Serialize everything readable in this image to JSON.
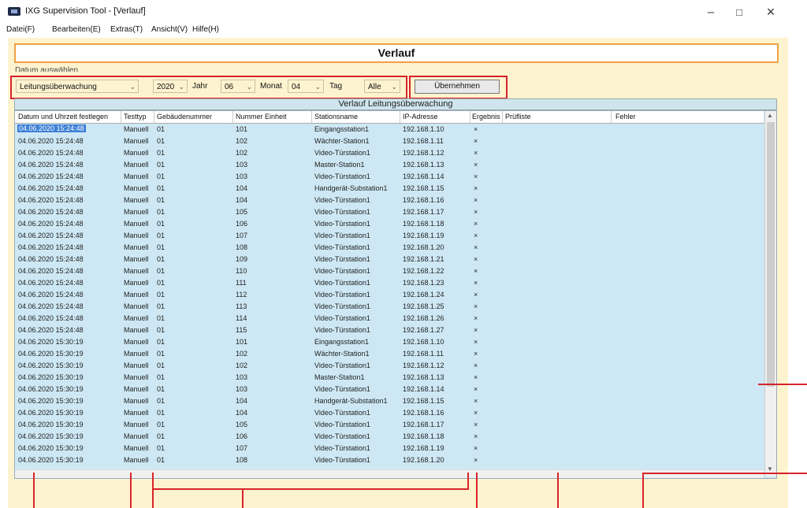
{
  "window": {
    "title": "IXG Supervision Tool - [Verlauf]",
    "controls": {
      "minimize": "–",
      "maximize": "□",
      "close": "×"
    }
  },
  "menu": [
    "Datei(F)",
    "Bearbeiten(E)",
    "Extras(T)",
    "Ansicht(V)",
    "Hilfe(H)"
  ],
  "header": {
    "title": "Verlauf"
  },
  "filter": {
    "label": "Datum auswählen",
    "type_value": "Leitungsüberwachung",
    "year_value": "2020",
    "year_label": "Jahr",
    "month_value": "06",
    "month_label": "Monat",
    "day_value": "04",
    "day_label": "Tag",
    "all_value": "Alle",
    "apply_label": "Übernehmen"
  },
  "table": {
    "title": "Verlauf Leitungsüberwachung",
    "columns": [
      "Datum und Uhrzeit festlegen",
      "Testtyp",
      "Gebäudenummer",
      "Nummer Einheit",
      "Stationsname",
      "IP-Adresse",
      "Ergebnis",
      "Prüfliste",
      "Fehler"
    ],
    "rows": [
      [
        "04.06.2020 15:24:48",
        "Manuell",
        "01",
        "101",
        "Eingangsstation1",
        "192.168.1.10",
        "×"
      ],
      [
        "04.06.2020 15:24:48",
        "Manuell",
        "01",
        "102",
        "Wächter-Station1",
        "192.168.1.11",
        "×"
      ],
      [
        "04.06.2020 15:24:48",
        "Manuell",
        "01",
        "102",
        "Video-Türstation1",
        "192.168.1.12",
        "×"
      ],
      [
        "04.06.2020 15:24:48",
        "Manuell",
        "01",
        "103",
        "Master-Station1",
        "192.168.1.13",
        "×"
      ],
      [
        "04.06.2020 15:24:48",
        "Manuell",
        "01",
        "103",
        "Video-Türstation1",
        "192.168.1.14",
        "×"
      ],
      [
        "04.06.2020 15:24:48",
        "Manuell",
        "01",
        "104",
        "Handgerät-Substation1",
        "192.168.1.15",
        "×"
      ],
      [
        "04.06.2020 15:24:48",
        "Manuell",
        "01",
        "104",
        "Video-Türstation1",
        "192.168.1.16",
        "×"
      ],
      [
        "04.06.2020 15:24:48",
        "Manuell",
        "01",
        "105",
        "Video-Türstation1",
        "192.168.1.17",
        "×"
      ],
      [
        "04.06.2020 15:24:48",
        "Manuell",
        "01",
        "106",
        "Video-Türstation1",
        "192.168.1.18",
        "×"
      ],
      [
        "04.06.2020 15:24:48",
        "Manuell",
        "01",
        "107",
        "Video-Türstation1",
        "192.168.1.19",
        "×"
      ],
      [
        "04.06.2020 15:24:48",
        "Manuell",
        "01",
        "108",
        "Video-Türstation1",
        "192.168.1.20",
        "×"
      ],
      [
        "04.06.2020 15:24:48",
        "Manuell",
        "01",
        "109",
        "Video-Türstation1",
        "192.168.1.21",
        "×"
      ],
      [
        "04.06.2020 15:24:48",
        "Manuell",
        "01",
        "110",
        "Video-Türstation1",
        "192.168.1.22",
        "×"
      ],
      [
        "04.06.2020 15:24:48",
        "Manuell",
        "01",
        "111",
        "Video-Türstation1",
        "192.168.1.23",
        "×"
      ],
      [
        "04.06.2020 15:24:48",
        "Manuell",
        "01",
        "112",
        "Video-Türstation1",
        "192.168.1.24",
        "×"
      ],
      [
        "04.06.2020 15:24:48",
        "Manuell",
        "01",
        "113",
        "Video-Türstation1",
        "192.168.1.25",
        "×"
      ],
      [
        "04.06.2020 15:24:48",
        "Manuell",
        "01",
        "114",
        "Video-Türstation1",
        "192.168.1.26",
        "×"
      ],
      [
        "04.06.2020 15:24:48",
        "Manuell",
        "01",
        "115",
        "Video-Türstation1",
        "192.168.1.27",
        "×"
      ],
      [
        "04.06.2020 15:30:19",
        "Manuell",
        "01",
        "101",
        "Eingangsstation1",
        "192.168.1.10",
        "×"
      ],
      [
        "04.06.2020 15:30:19",
        "Manuell",
        "01",
        "102",
        "Wächter-Station1",
        "192.168.1.11",
        "×"
      ],
      [
        "04.06.2020 15:30:19",
        "Manuell",
        "01",
        "102",
        "Video-Türstation1",
        "192.168.1.12",
        "×"
      ],
      [
        "04.06.2020 15:30:19",
        "Manuell",
        "01",
        "103",
        "Master-Station1",
        "192.168.1.13",
        "×"
      ],
      [
        "04.06.2020 15:30:19",
        "Manuell",
        "01",
        "103",
        "Video-Türstation1",
        "192.168.1.14",
        "×"
      ],
      [
        "04.06.2020 15:30:19",
        "Manuell",
        "01",
        "104",
        "Handgerät-Substation1",
        "192.168.1.15",
        "×"
      ],
      [
        "04.06.2020 15:30:19",
        "Manuell",
        "01",
        "104",
        "Video-Türstation1",
        "192.168.1.16",
        "×"
      ],
      [
        "04.06.2020 15:30:19",
        "Manuell",
        "01",
        "105",
        "Video-Türstation1",
        "192.168.1.17",
        "×"
      ],
      [
        "04.06.2020 15:30:19",
        "Manuell",
        "01",
        "106",
        "Video-Türstation1",
        "192.168.1.18",
        "×"
      ],
      [
        "04.06.2020 15:30:19",
        "Manuell",
        "01",
        "107",
        "Video-Türstation1",
        "192.168.1.19",
        "×"
      ],
      [
        "04.06.2020 15:30:19",
        "Manuell",
        "01",
        "108",
        "Video-Türstation1",
        "192.168.1.20",
        "×"
      ]
    ]
  },
  "colors": {
    "highlight": "#d8232a",
    "background": "#fdf3cf",
    "grid": "#cde8f4",
    "selection": "#3d7fd6",
    "header_border": "#f0a040"
  }
}
